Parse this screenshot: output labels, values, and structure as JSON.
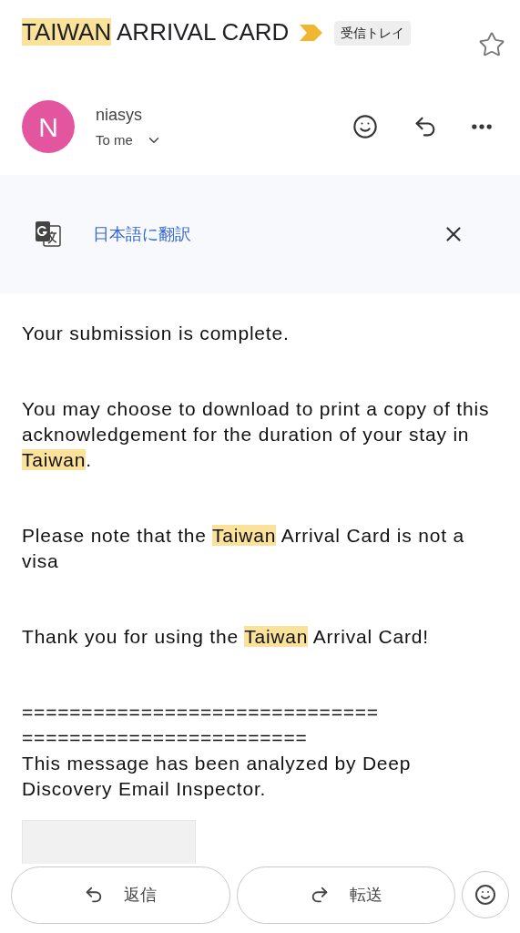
{
  "subject": {
    "parts": [
      {
        "text": "TAIWAN",
        "highlight": true
      },
      {
        "text": " ARRIVAL CARD",
        "highlight": false
      }
    ],
    "label": "受信トレイ",
    "important": true,
    "starred": false
  },
  "sender": {
    "initial": "N",
    "name": "niasys",
    "recipient": "To me"
  },
  "translate": {
    "link": "日本語に翻訳"
  },
  "body": [
    [
      {
        "text": "Your submission is complete.",
        "highlight": false
      }
    ],
    [
      {
        "text": "You may choose to download to print a copy of this acknowledgement for the duration of your stay in ",
        "highlight": false
      },
      {
        "text": "Taiwan",
        "highlight": true
      },
      {
        "text": ".",
        "highlight": false
      }
    ],
    [
      {
        "text": "Please note that the ",
        "highlight": false
      },
      {
        "text": "Taiwan",
        "highlight": true
      },
      {
        "text": " Arrival Card is not a visa",
        "highlight": false
      }
    ],
    [
      {
        "text": "Thank you for using the ",
        "highlight": false
      },
      {
        "text": "Taiwan",
        "highlight": true
      },
      {
        "text": " Arrival Card!",
        "highlight": false
      }
    ]
  ],
  "footer": {
    "rules": [
      "==============================",
      "========================"
    ],
    "note": "This message has been analyzed by Deep Discovery Email Inspector."
  },
  "attachment": {
    "kind": "picture"
  },
  "actions": [
    {
      "label": "返信",
      "kind": "reply"
    },
    {
      "label": "転送",
      "kind": "forward"
    }
  ]
}
